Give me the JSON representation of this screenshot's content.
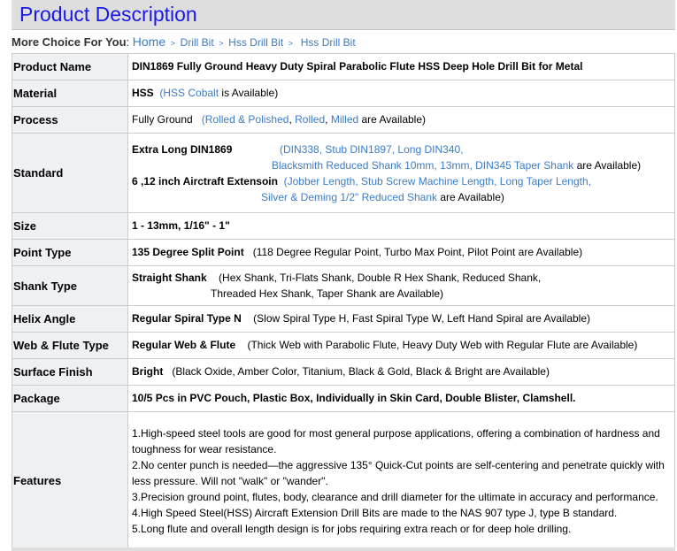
{
  "header": {
    "title": "Product Description"
  },
  "breadcrumb": {
    "lead": "More Choice For You",
    "colon": ":",
    "home": "Home",
    "sep": ">",
    "items": [
      "Drill Bit",
      "Hss Drill Bit",
      "Hss Drill Bit"
    ]
  },
  "colors": {
    "title": "#1a1ae6",
    "link": "#3a7cc8",
    "label_bg": "#eef0f4",
    "bar_bg": "#dedede"
  },
  "rows": {
    "product_name": {
      "label": "Product Name",
      "value": "DIN1869 Fully Ground Heavy Duty Spiral Parabolic Flute HSS Deep Hole Drill Bit for Metal"
    },
    "material": {
      "label": "Material",
      "main": "HSS",
      "open": "(",
      "link": "HSS Cobalt",
      "tail": " is Available)"
    },
    "process": {
      "label": "Process",
      "main": "Fully Ground",
      "open": "(",
      "links": [
        "Rolled & Polished",
        "Rolled",
        "Milled"
      ],
      "tail": " are Available)"
    },
    "standard": {
      "label": "Standard",
      "line1_main": "Extra Long DIN1869",
      "line1_links": [
        "(DIN338",
        "Stub DIN1897",
        "Long DIN340"
      ],
      "line2_links": [
        "Blacksmith Reduced Shank 10mm",
        "13mm",
        "DIN345 Taper Shank"
      ],
      "line2_tail": " are Available)",
      "line3_main": "6 ,12 inch Airctraft Extensoin",
      "line3_links": [
        "(Jobber Length",
        "Stub Screw Machine Length",
        "Long Taper Length"
      ],
      "line4_link": "Silver & Deming 1/2\" Reduced Shank",
      "line4_tail": " are Available)"
    },
    "size": {
      "label": "Size",
      "value": "1 - 13mm, 1/16\" - 1\""
    },
    "point_type": {
      "label": "Point Type",
      "main": "135 Degree Split Point",
      "rest": "(118 Degree Regular Point, Turbo Max Point, Pilot Point are Available)"
    },
    "shank_type": {
      "label": "Shank Type",
      "main": "Straight Shank",
      "rest1": "(Hex Shank, Tri-Flats Shank, Double R Hex Shank, Reduced Shank,",
      "rest2": "Threaded Hex Shank, Taper Shank are Available)"
    },
    "helix_angle": {
      "label": "Helix Angle",
      "main": "Regular Spiral Type N",
      "rest": "(Slow Spiral Type H, Fast Spiral Type W, Left Hand Spiral are Available)"
    },
    "web_flute": {
      "label": "Web & Flute Type",
      "main": "Regular Web & Flute",
      "rest": "(Thick Web with Parabolic Flute, Heavy Duty Web with Regular Flute are Available)"
    },
    "surface_finish": {
      "label": "Surface Finish",
      "main": "Bright",
      "rest": "(Black Oxide, Amber Color, Titanium, Black & Gold, Black & Bright are Available)"
    },
    "package": {
      "label": "Package",
      "value": "10/5 Pcs in PVC Pouch, Plastic Box, Individually in Skin Card, Double Blister, Clamshell."
    },
    "features": {
      "label": "Features",
      "items": [
        "1.High-speed steel tools are good for most general purpose applications, offering a combination of hardness and toughness for wear resistance.",
        "2.No center punch is needed—the aggressive 135° Quick-Cut points are self-centering and penetrate quickly with less pressure. Will not \"walk\" or \"wander\".",
        "3.Precision ground point, flutes, body, clearance and drill diameter for the ultimate in accuracy and performance.",
        "4.High Speed Steel(HSS) Aircraft Extension Drill Bits are made to the NAS 907 type J, type B standard.",
        "5.Long flute and overall length design is for jobs requiring extra reach or for deep hole drilling."
      ]
    }
  }
}
